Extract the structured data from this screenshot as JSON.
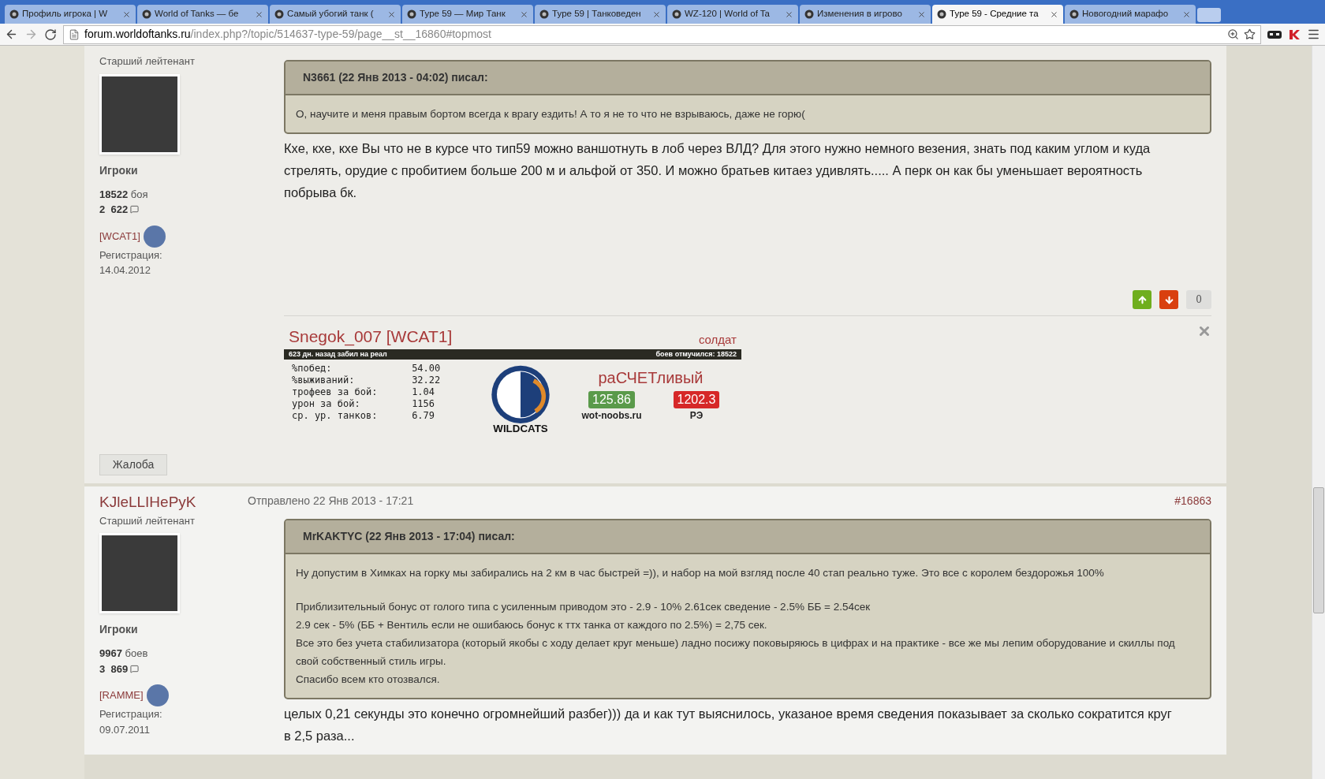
{
  "browser": {
    "tabs": [
      {
        "title": "Профиль игрока | W",
        "selected": false
      },
      {
        "title": "World of Tanks — бе",
        "selected": false
      },
      {
        "title": "Самый убогий танк (",
        "selected": false
      },
      {
        "title": "Type 59 — Мир Танк",
        "selected": false
      },
      {
        "title": "Type 59 | Танковеден",
        "selected": false
      },
      {
        "title": "WZ-120 | World of Ta",
        "selected": false
      },
      {
        "title": "Изменения в игрово",
        "selected": false
      },
      {
        "title": "Type 59 - Средние та",
        "selected": true
      },
      {
        "title": "Новогодний марафо",
        "selected": false
      }
    ],
    "url_host": "forum.worldoftanks.ru",
    "url_path": "/index.php?/topic/514637-type-59/page__st__16860#topmost"
  },
  "posts": [
    {
      "rank": "Старший лейтенант",
      "group": "Игроки",
      "battles_count": "18522",
      "battles_label": "боя",
      "posts_count": "2  622",
      "clan": "[WCAT1]",
      "registration_label": "Регистрация:",
      "registration_date": "14.04.2012",
      "quote": {
        "header": "N3661 (22 Янв 2013 - 04:02) писал:",
        "paragraphs": [
          [
            "О, научите и меня правым бортом всегда к врагу ездить! А то я не то что не взрываюсь, даже не горю("
          ]
        ]
      },
      "body": "Кхе, кхе, кхе Вы что не в курсе что тип59 можно ваншотнуть в лоб через ВЛД? Для этого нужно немного везения, знать под каким углом и куда стрелять, орудие с пробитием больше 200 м и альфой от 350. И можно братьев китаез удивлять..... А перк он как бы уменьшает вероятность побрыва бк.",
      "vote_count": "0",
      "signature": {
        "name": "Snegok_007 [WCAT1]",
        "rank": "солдат",
        "bar_left": "623 дн. назад забил на реал",
        "bar_right": "боев отмучился: 18522",
        "stats": [
          {
            "label": "%побед:",
            "value": "54.00"
          },
          {
            "label": "%выживаний:",
            "value": "32.22"
          },
          {
            "label": "трофеев за бой:",
            "value": "1.04"
          },
          {
            "label": "урон за бой:",
            "value": "1156"
          },
          {
            "label": "ср. ур. танков:",
            "value": "6.79"
          }
        ],
        "logo_text": "WILDCATS",
        "rating_title": "раСЧЕТливый",
        "ratings": [
          {
            "value": "125.86",
            "label": "wot-noobs.ru",
            "color": "#5a9a4a"
          },
          {
            "value": "1202.3",
            "label": "РЭ",
            "color": "#d62828"
          }
        ]
      },
      "complaint_button": "Жалоба"
    },
    {
      "author": "KJleLLIHePyK",
      "posted": "Отправлено 22 Янв 2013 - 17:21",
      "post_number": "#16863",
      "rank": "Старший лейтенант",
      "group": "Игроки",
      "battles_count": "9967",
      "battles_label": "боев",
      "posts_count": "3  869",
      "clan": "[RAMME]",
      "registration_label": "Регистрация:",
      "registration_date": "09.07.2011",
      "quote": {
        "header": "MrKAKTYC (22 Янв 2013 - 17:04) писал:",
        "paragraphs": [
          [
            "Ну допустим в Химках на горку мы забирались на 2 км в час быстрей =)), и набор на мой взгляд после 40 стап реально туже. Это все с королем бездорожья 100%"
          ],
          [
            "Приблизительный бонус от голого типа с усиленным приводом это - 2.9 - 10% 2.61сек сведение - 2.5% ББ = 2.54сек",
            "2.9 сек - 5% (ББ + Вентиль если не ошибаюсь бонус к ттх танка от каждого по 2.5%) = 2,75 сек.",
            "Все это без учета стабилизатора (который якобы с ходу делает круг меньше) ладно посижу поковыряюсь в цифрах и на практике - все же мы лепим оборудование и скиллы под свой собственный стиль игры.",
            "Спасибо всем кто отозвался."
          ]
        ]
      },
      "body": "целых 0,21 секунды это конечно огромнейший разбег))) да и как тут выяснилось, указаное время сведения показывает за сколько сократится круг в 2,5 раза..."
    }
  ]
}
